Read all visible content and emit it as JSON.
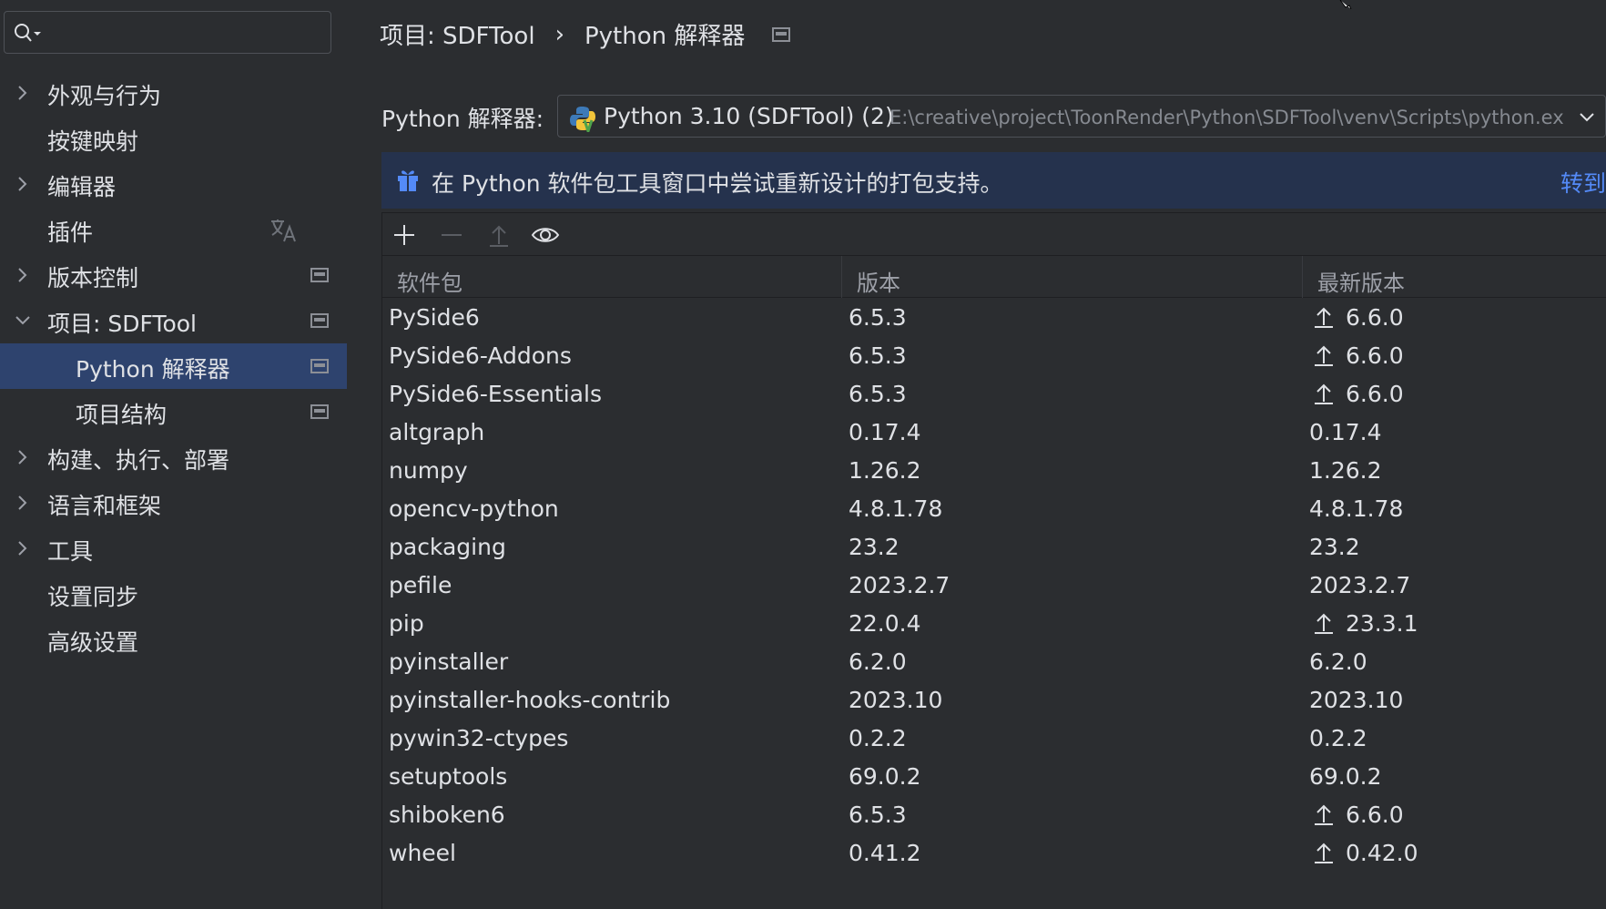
{
  "sidebar": {
    "search": {
      "value": "",
      "placeholder": ""
    },
    "items": [
      {
        "label": "外观与行为",
        "expandable": true,
        "expanded": false
      },
      {
        "label": "按键映射",
        "expandable": false
      },
      {
        "label": "编辑器",
        "expandable": true,
        "expanded": false
      },
      {
        "label": "插件",
        "expandable": false,
        "icon": "translate-icon"
      },
      {
        "label": "版本控制",
        "expandable": true,
        "expanded": false,
        "icon": "project-scope-icon"
      },
      {
        "label": "项目: SDFTool",
        "expandable": true,
        "expanded": true,
        "icon": "project-scope-icon"
      },
      {
        "label": "Python 解释器",
        "sub": true,
        "selected": true,
        "icon": "project-scope-icon"
      },
      {
        "label": "项目结构",
        "sub": true,
        "icon": "project-scope-icon"
      },
      {
        "label": "构建、执行、部署",
        "expandable": true,
        "expanded": false
      },
      {
        "label": "语言和框架",
        "expandable": true,
        "expanded": false
      },
      {
        "label": "工具",
        "expandable": true,
        "expanded": false
      },
      {
        "label": "设置同步",
        "expandable": false
      },
      {
        "label": "高级设置",
        "expandable": false
      }
    ]
  },
  "breadcrumb": {
    "parent": "项目: SDFTool",
    "separator": "›",
    "current": "Python 解释器"
  },
  "interpreter": {
    "label": "Python 解释器:",
    "name": "Python 3.10 (SDFTool) (2)",
    "path": "E:\\creative\\project\\ToonRender\\Python\\SDFTool\\venv\\Scripts\\python.exe"
  },
  "banner": {
    "message": "在 Python 软件包工具窗口中尝试重新设计的打包支持。",
    "link": "转到"
  },
  "toolbar": {
    "buttons": [
      "add-icon",
      "remove-icon",
      "upgrade-icon",
      "show-early-releases-icon"
    ]
  },
  "table": {
    "headers": {
      "package": "软件包",
      "version": "版本",
      "latest": "最新版本"
    },
    "rows": [
      {
        "package": "PySide6",
        "version": "6.5.3",
        "latest": "6.6.0",
        "upgrade": true
      },
      {
        "package": "PySide6-Addons",
        "version": "6.5.3",
        "latest": "6.6.0",
        "upgrade": true
      },
      {
        "package": "PySide6-Essentials",
        "version": "6.5.3",
        "latest": "6.6.0",
        "upgrade": true
      },
      {
        "package": "altgraph",
        "version": "0.17.4",
        "latest": "0.17.4",
        "upgrade": false
      },
      {
        "package": "numpy",
        "version": "1.26.2",
        "latest": "1.26.2",
        "upgrade": false
      },
      {
        "package": "opencv-python",
        "version": "4.8.1.78",
        "latest": "4.8.1.78",
        "upgrade": false
      },
      {
        "package": "packaging",
        "version": "23.2",
        "latest": "23.2",
        "upgrade": false
      },
      {
        "package": "pefile",
        "version": "2023.2.7",
        "latest": "2023.2.7",
        "upgrade": false
      },
      {
        "package": "pip",
        "version": "22.0.4",
        "latest": "23.3.1",
        "upgrade": true
      },
      {
        "package": "pyinstaller",
        "version": "6.2.0",
        "latest": "6.2.0",
        "upgrade": false
      },
      {
        "package": "pyinstaller-hooks-contrib",
        "version": "2023.10",
        "latest": "2023.10",
        "upgrade": false
      },
      {
        "package": "pywin32-ctypes",
        "version": "0.2.2",
        "latest": "0.2.2",
        "upgrade": false
      },
      {
        "package": "setuptools",
        "version": "69.0.2",
        "latest": "69.0.2",
        "upgrade": false
      },
      {
        "package": "shiboken6",
        "version": "6.5.3",
        "latest": "6.6.0",
        "upgrade": true
      },
      {
        "package": "wheel",
        "version": "0.41.2",
        "latest": "0.42.0",
        "upgrade": true
      }
    ]
  },
  "colors": {
    "background": "#2b2d30",
    "selected": "#2e436e",
    "banner": "#25324d",
    "link": "#548af7",
    "text": "#dfe1e5",
    "muted": "#868a91"
  }
}
